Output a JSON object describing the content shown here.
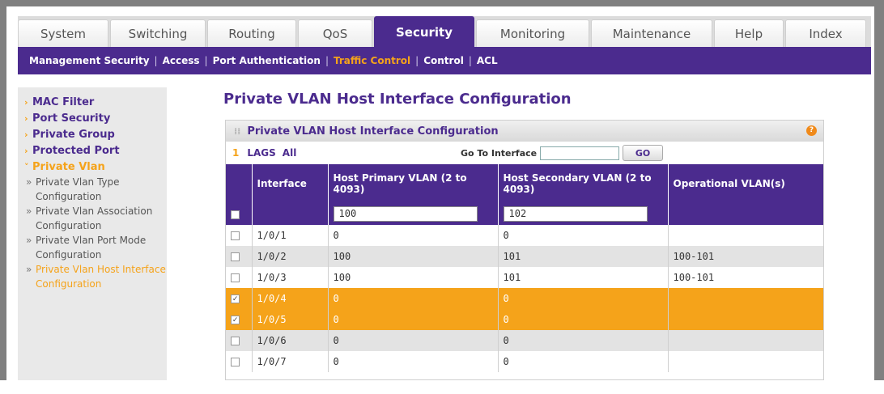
{
  "tabs": [
    "System",
    "Switching",
    "Routing",
    "QoS",
    "Security",
    "Monitoring",
    "Maintenance",
    "Help",
    "Index"
  ],
  "active_tab": "Security",
  "subnav": [
    "Management Security",
    "Access",
    "Port Authentication",
    "Traffic Control",
    "Control",
    "ACL"
  ],
  "active_subnav": "Traffic Control",
  "leftnav": {
    "items": [
      {
        "label": "MAC Filter"
      },
      {
        "label": "Port Security"
      },
      {
        "label": "Private Group"
      },
      {
        "label": "Protected Port"
      },
      {
        "label": "Private Vlan"
      }
    ],
    "subitems": [
      "Private Vlan Type Configuration",
      "Private Vlan Association Configuration",
      "Private Vlan Port Mode Configuration",
      "Private Vlan Host Interface Configuration"
    ]
  },
  "page_title": "Private VLAN Host Interface Configuration",
  "panel": {
    "title": "Private VLAN Host Interface Configuration",
    "help_icon": "?",
    "filter_num": "1",
    "filter_lags": "LAGS",
    "filter_all": "All",
    "goto_label": "Go To Interface",
    "goto_value": "",
    "go_button": "GO"
  },
  "table": {
    "headers": [
      "Interface",
      "Host Primary VLAN (2 to 4093)",
      "Host Secondary VLAN (2 to 4093)",
      "Operational VLAN(s)"
    ],
    "edit_row": {
      "primary": "100",
      "secondary": "102"
    },
    "rows": [
      {
        "interface": "1/0/1",
        "primary": "0",
        "secondary": "0",
        "operational": "",
        "checked": false,
        "style": "r-white"
      },
      {
        "interface": "1/0/2",
        "primary": "100",
        "secondary": "101",
        "operational": "100-101",
        "checked": false,
        "style": "r-gray"
      },
      {
        "interface": "1/0/3",
        "primary": "100",
        "secondary": "101",
        "operational": "100-101",
        "checked": false,
        "style": "r-white"
      },
      {
        "interface": "1/0/4",
        "primary": "0",
        "secondary": "0",
        "operational": "",
        "checked": true,
        "style": "r-sel"
      },
      {
        "interface": "1/0/5",
        "primary": "0",
        "secondary": "0",
        "operational": "",
        "checked": true,
        "style": "r-sel"
      },
      {
        "interface": "1/0/6",
        "primary": "0",
        "secondary": "0",
        "operational": "",
        "checked": false,
        "style": "r-gray"
      },
      {
        "interface": "1/0/7",
        "primary": "0",
        "secondary": "0",
        "operational": "",
        "checked": false,
        "style": "r-white"
      }
    ]
  },
  "colors": {
    "brand_purple": "#4b2b8e",
    "accent_orange": "#f5a31a"
  }
}
